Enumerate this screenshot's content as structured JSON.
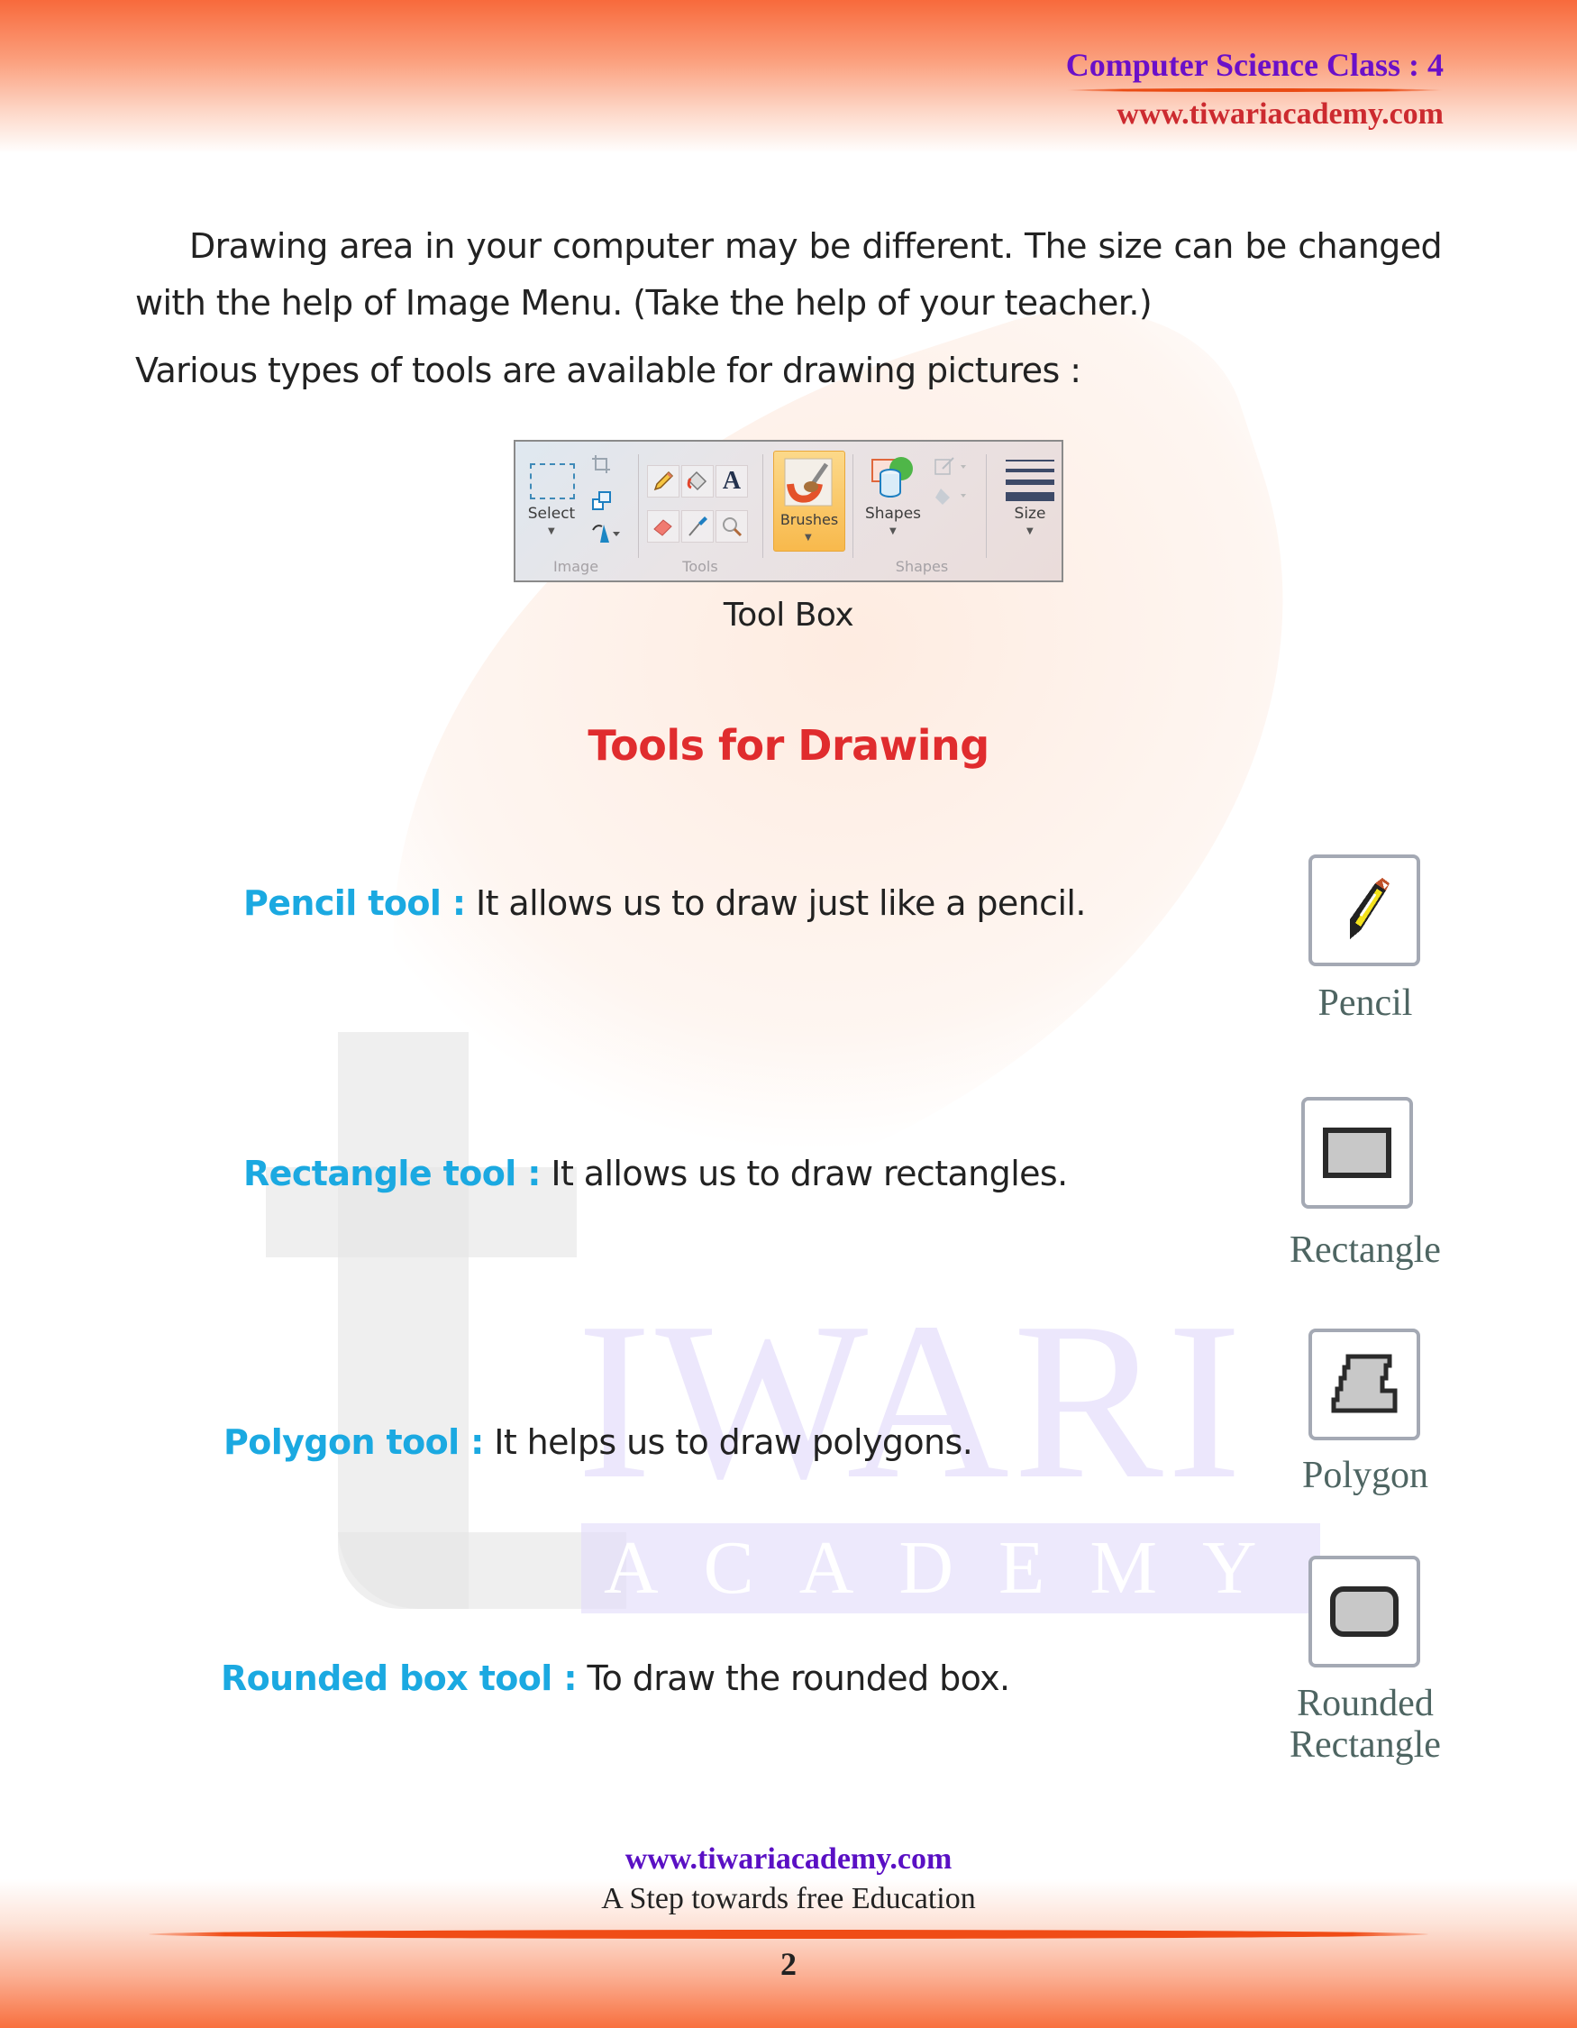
{
  "header": {
    "title": "Computer Science Class : 4",
    "url": "www.tiwariacademy.com",
    "title_color": "#6a10c9",
    "url_color": "#cc2a2f"
  },
  "watermark": {
    "word1": "IWARI",
    "word2": "ACADEMY"
  },
  "intro": {
    "paragraph": "Drawing area in your computer may be different. The size can be changed with the help of Image Menu. (Take the help of your teacher.)",
    "lead_in": "Various types of tools are available for drawing pictures :"
  },
  "toolbox": {
    "caption": "Tool Box",
    "groups": [
      {
        "label": "Image",
        "buttons": [
          "Select"
        ],
        "icons": [
          "select-rectangle-icon",
          "crop-icon",
          "resize-icon",
          "rotate-icon"
        ]
      },
      {
        "label": "Tools",
        "icons": [
          "pencil-icon",
          "fill-icon",
          "text-icon",
          "eraser-icon",
          "color-picker-icon",
          "magnifier-icon"
        ]
      },
      {
        "label": "",
        "buttons": [
          "Brushes"
        ],
        "icons": [
          "brush-icon"
        ],
        "active": true
      },
      {
        "label": "Shapes",
        "buttons": [
          "Shapes"
        ],
        "icons": [
          "shapes-icon",
          "outline-icon",
          "fill-shape-icon"
        ]
      },
      {
        "label": "",
        "buttons": [
          "Size"
        ],
        "icons": [
          "size-lines-icon"
        ]
      }
    ],
    "glyphs": {
      "text": "A"
    }
  },
  "section": {
    "title": "Tools for Drawing",
    "title_color": "#e02c2e"
  },
  "tools": [
    {
      "name": "Pencil tool :",
      "description": " It allows us to draw just like a pencil.",
      "icon_label": "Pencil",
      "icon": "pencil-icon"
    },
    {
      "name": "Rectangle tool :",
      "description": " It allows us to draw rectangles.",
      "icon_label": "Rectangle",
      "icon": "rectangle-icon"
    },
    {
      "name": "Polygon tool :",
      "description": " It helps us to draw polygons.",
      "icon_label": "Polygon",
      "icon": "polygon-icon"
    },
    {
      "name": "Rounded box tool :",
      "description": " To draw the rounded box.",
      "icon_label_line1": "Rounded",
      "icon_label_line2": "Rectangle",
      "icon": "rounded-rectangle-icon"
    }
  ],
  "footer": {
    "url": "www.tiwariacademy.com",
    "tagline": "A Step towards free Education",
    "page_number": "2"
  }
}
